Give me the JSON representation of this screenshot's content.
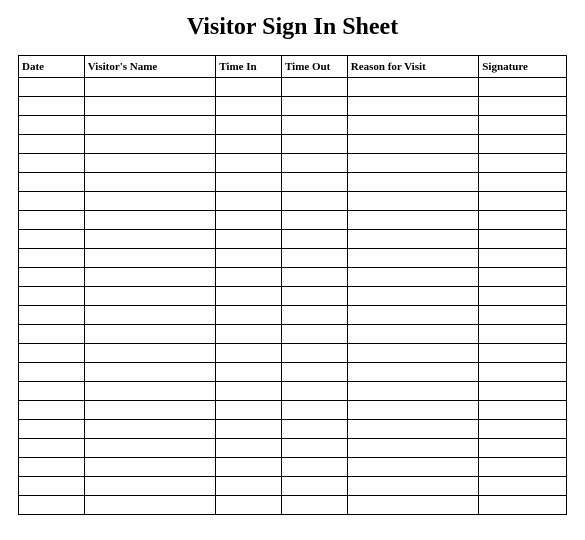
{
  "title": "Visitor Sign In Sheet",
  "columns": [
    {
      "label": "Date"
    },
    {
      "label": "Visitor's Name"
    },
    {
      "label": "Time In"
    },
    {
      "label": "Time Out"
    },
    {
      "label": "Reason for Visit"
    },
    {
      "label": "Signature"
    }
  ],
  "row_count": 23
}
